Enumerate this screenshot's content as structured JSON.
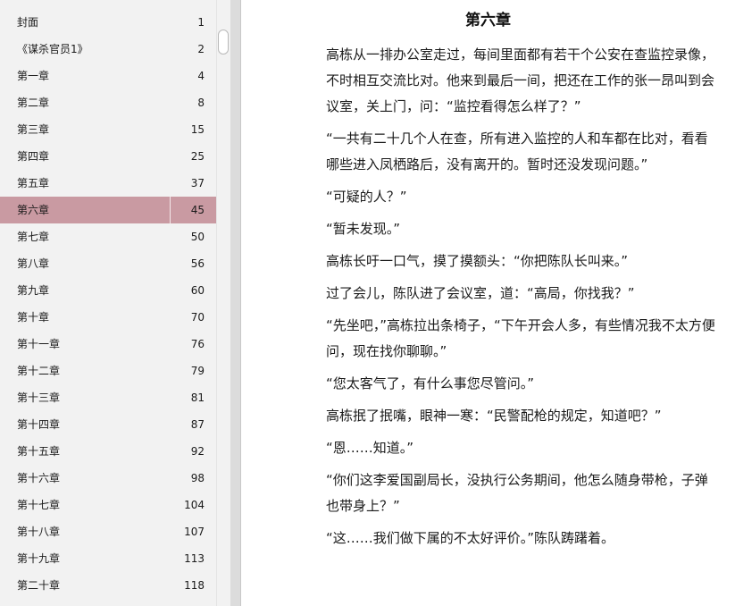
{
  "toc": {
    "items": [
      {
        "title": "封面",
        "page": "1"
      },
      {
        "title": "《谋杀官员1》",
        "page": "2"
      },
      {
        "title": "第一章",
        "page": "4"
      },
      {
        "title": "第二章",
        "page": "8"
      },
      {
        "title": "第三章",
        "page": "15"
      },
      {
        "title": "第四章",
        "page": "25"
      },
      {
        "title": "第五章",
        "page": "37"
      },
      {
        "title": "第六章",
        "page": "45"
      },
      {
        "title": "第七章",
        "page": "50"
      },
      {
        "title": "第八章",
        "page": "56"
      },
      {
        "title": "第九章",
        "page": "60"
      },
      {
        "title": "第十章",
        "page": "70"
      },
      {
        "title": "第十一章",
        "page": "76"
      },
      {
        "title": "第十二章",
        "page": "79"
      },
      {
        "title": "第十三章",
        "page": "81"
      },
      {
        "title": "第十四章",
        "page": "87"
      },
      {
        "title": "第十五章",
        "page": "92"
      },
      {
        "title": "第十六章",
        "page": "98"
      },
      {
        "title": "第十七章",
        "page": "104"
      },
      {
        "title": "第十八章",
        "page": "107"
      },
      {
        "title": "第十九章",
        "page": "113"
      },
      {
        "title": "第二十章",
        "page": "118"
      }
    ],
    "active_index": 7,
    "active_color": "#c99aa2"
  },
  "reader": {
    "chapter_title": "第六章",
    "paragraphs": [
      "高栋从一排办公室走过，每间里面都有若干个公安在查监控录像，不时相互交流比对。他来到最后一间，把还在工作的张一昂叫到会议室，关上门，问：“监控看得怎么样了？”",
      "“一共有二十几个人在查，所有进入监控的人和车都在比对，看看哪些进入凤栖路后，没有离开的。暂时还没发现问题。”",
      "“可疑的人？”",
      "“暂未发现。”",
      "高栋长吁一口气，摸了摸额头：“你把陈队长叫来。”",
      "过了会儿，陈队进了会议室，道：“高局，你找我？”",
      "“先坐吧，”高栋拉出条椅子，“下午开会人多，有些情况我不太方便问，现在找你聊聊。”",
      "“您太客气了，有什么事您尽管问。”",
      "高栋抿了抿嘴，眼神一寒：“民警配枪的规定，知道吧？”",
      "“恩……知道。”",
      "“你们这李爱国副局长，没执行公务期间，他怎么随身带枪，子弹也带身上？”",
      "“这……我们做下属的不太好评价。”陈队踌躇着。"
    ]
  }
}
